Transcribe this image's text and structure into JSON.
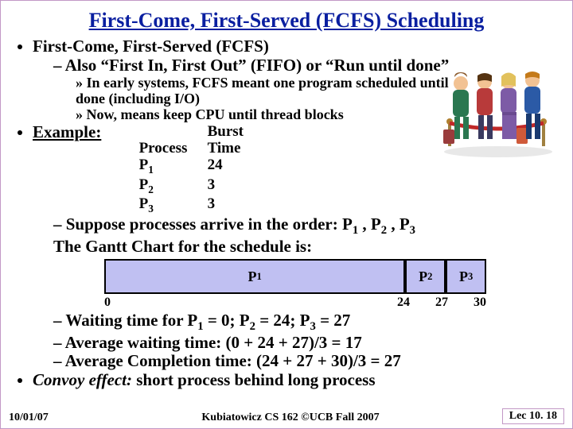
{
  "title": "First-Come, First-Served (FCFS) Scheduling",
  "bullets": {
    "b1": "First-Come, First-Served (FCFS)",
    "b1a": "Also “First In, First Out” (FIFO) or “Run until done”",
    "b1a_i": "In early systems, FCFS meant one program scheduled until done (including I/O)",
    "b1a_ii": "Now, means keep CPU until thread blocks",
    "b2_label": "Example:",
    "b2_suppose_before": "Suppose processes arrive in the order: P",
    "b2_suppose_mid1": " , P",
    "b2_suppose_mid2": " , P",
    "b2_suppose_line2": "The Gantt Chart for the schedule is:",
    "b2_wait_before": "Waiting time for P",
    "b2_wait_mid1": " = 0; P",
    "b2_wait_mid2": " = 24; P",
    "b2_wait_mid3": " = 27",
    "b2_avg_wait": "Average waiting time: (0 + 24 + 27)/3 = 17",
    "b2_avg_comp": "Average Completion time: (24 + 27 + 30)/3 = 27",
    "b3_em": "Convoy effect:",
    "b3_after": " short process behind long process"
  },
  "table": {
    "head_process": "Process",
    "head_burst": "Burst Time",
    "rows": [
      {
        "p": "1",
        "burst": "24"
      },
      {
        "p": "2",
        "burst": "3"
      },
      {
        "p": "3",
        "burst": "3"
      }
    ]
  },
  "gantt": {
    "cells": [
      {
        "p": "1",
        "width": 80
      },
      {
        "p": "2",
        "width": 10
      },
      {
        "p": "3",
        "width": 10
      }
    ],
    "ticks": [
      "0",
      "24",
      "27",
      "30"
    ]
  },
  "footer": {
    "date": "10/01/07",
    "center": "Kubiatowicz CS 162 ©UCB Fall 2007",
    "right": "Lec 10. 18"
  }
}
